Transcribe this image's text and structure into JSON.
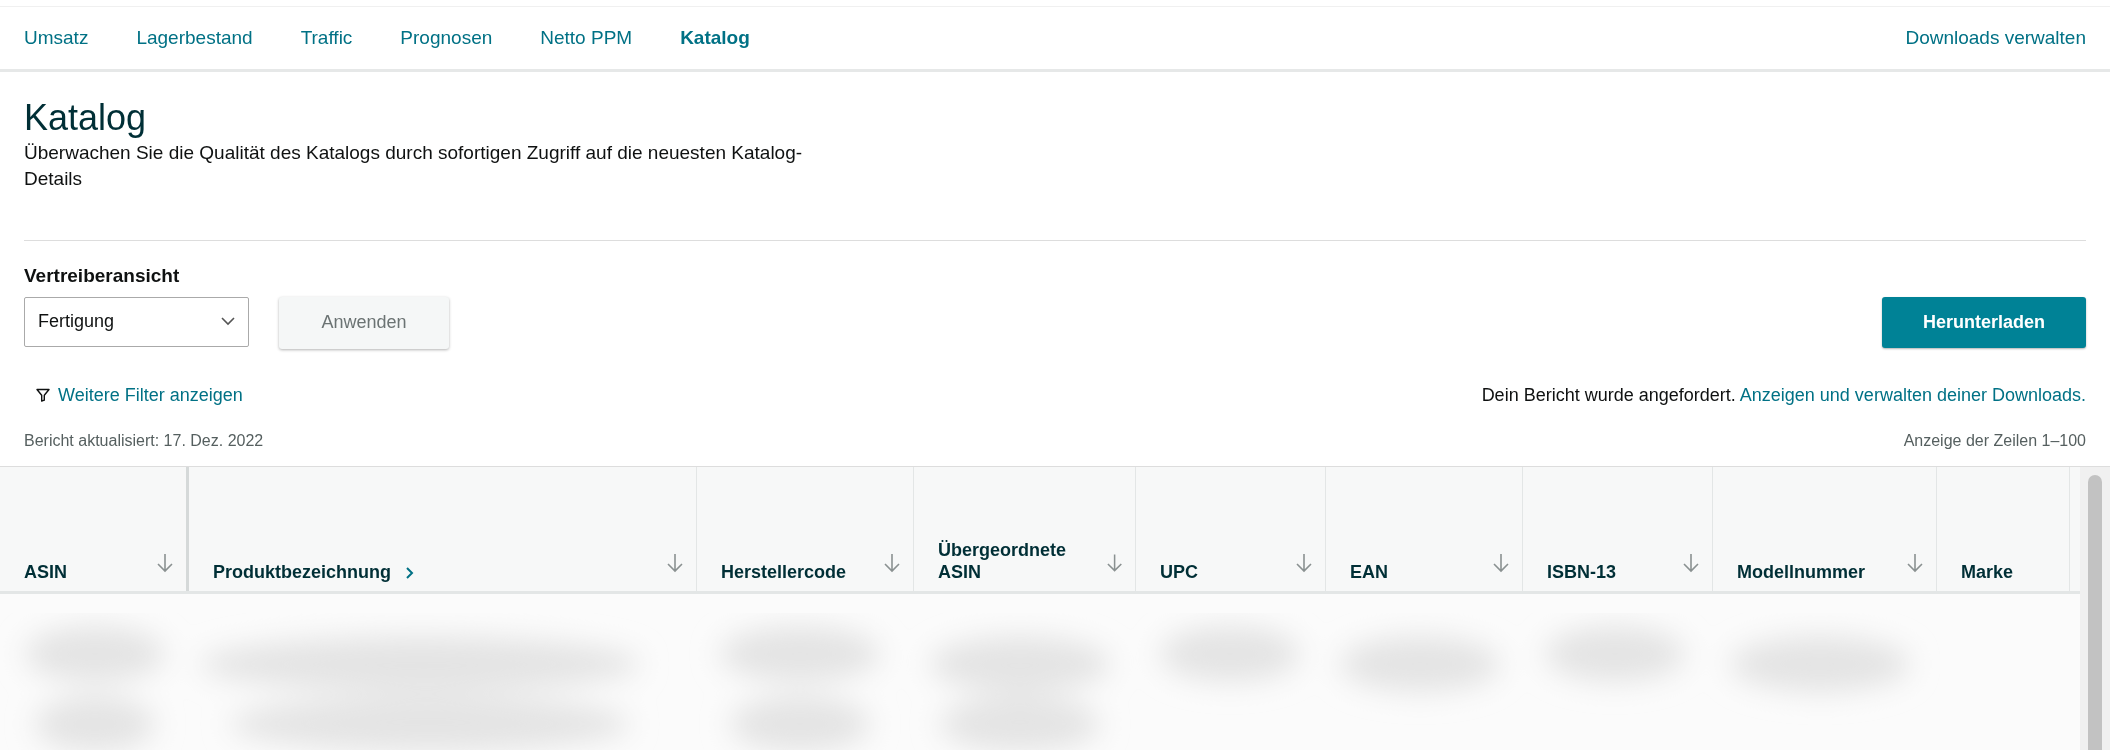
{
  "nav": {
    "tabs": [
      {
        "label": "Umsatz",
        "selected": false
      },
      {
        "label": "Lagerbestand",
        "selected": false
      },
      {
        "label": "Traffic",
        "selected": false
      },
      {
        "label": "Prognosen",
        "selected": false
      },
      {
        "label": "Netto PPM",
        "selected": false
      },
      {
        "label": "Katalog",
        "selected": true
      }
    ],
    "right_link": "Downloads verwalten"
  },
  "page": {
    "title": "Katalog",
    "description": "Überwachen Sie die Qualität des Katalogs durch sofortigen Zugriff auf die neuesten Katalog-Details"
  },
  "filters": {
    "label": "Vertreiberansicht",
    "select_value": "Fertigung",
    "apply_button": "Anwenden",
    "download_button": "Herunterladen",
    "more_filters_link": "Weitere Filter anzeigen"
  },
  "report_notice": {
    "text": "Dein Bericht wurde angefordert.",
    "link": "Anzeigen und verwalten deiner Downloads."
  },
  "updated": "Bericht aktualisiert: 17. Dez. 2022",
  "row_range": "Anzeige der Zeilen 1–100",
  "table": {
    "columns": [
      {
        "label": "ASIN",
        "sortable": true,
        "expandable": false
      },
      {
        "label": "Produktbezeichnung",
        "sortable": true,
        "expandable": true
      },
      {
        "label": "Herstellercode",
        "sortable": true,
        "expandable": false
      },
      {
        "label": "Übergeordnete ASIN",
        "sortable": true,
        "expandable": false
      },
      {
        "label": "UPC",
        "sortable": true,
        "expandable": false
      },
      {
        "label": "EAN",
        "sortable": true,
        "expandable": false
      },
      {
        "label": "ISBN-13",
        "sortable": true,
        "expandable": false
      },
      {
        "label": "Modellnummer",
        "sortable": true,
        "expandable": false
      },
      {
        "label": "Marke",
        "sortable": false,
        "expandable": false
      }
    ]
  }
}
